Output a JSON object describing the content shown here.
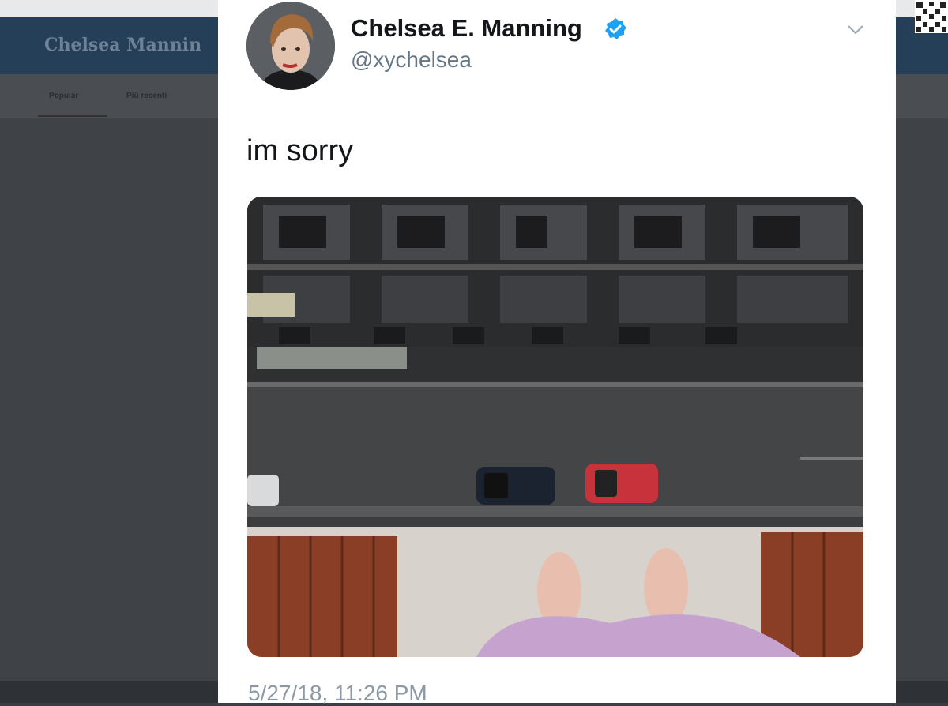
{
  "background": {
    "profile_name": "Chelsea Mannin",
    "nav_items": [
      "Popular",
      "Più recenti"
    ],
    "colors": {
      "header": "#263f58",
      "overlay": "#3f4348"
    }
  },
  "tweet": {
    "display_name": "Chelsea E. Manning",
    "handle": "@xychelsea",
    "verified": true,
    "text": "im sorry",
    "timestamp": "5/27/18, 11:26 PM",
    "icons": [
      "verified-badge-icon",
      "chevron-down-icon"
    ],
    "colors": {
      "verified": "#1da1f2",
      "text": "#14171a",
      "muted": "#657786"
    }
  }
}
